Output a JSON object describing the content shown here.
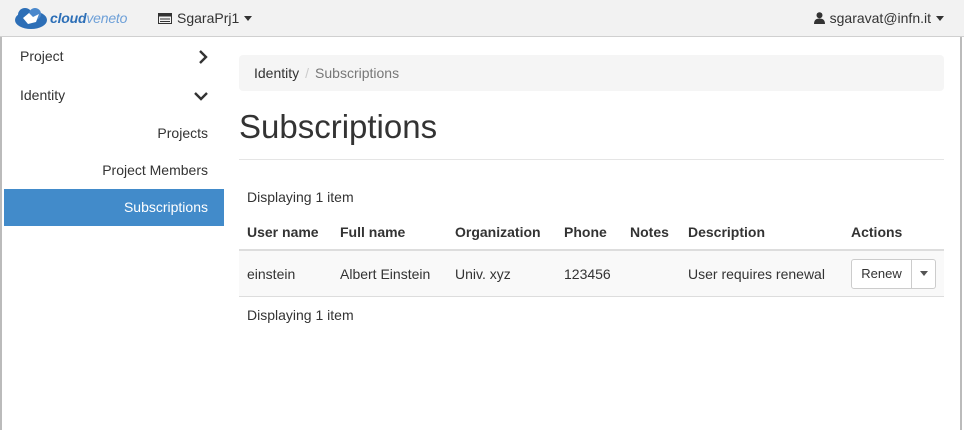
{
  "brand": {
    "name_bold": "cloud",
    "name_light": "veneto"
  },
  "topbar": {
    "project": "SgaraPrj1",
    "user": "sgaravat@infn.it"
  },
  "sidebar": {
    "sections": [
      {
        "label": "Project",
        "expanded": false
      },
      {
        "label": "Identity",
        "expanded": true
      }
    ],
    "identity_items": [
      {
        "label": "Projects",
        "active": false
      },
      {
        "label": "Project Members",
        "active": false
      },
      {
        "label": "Subscriptions",
        "active": true
      }
    ]
  },
  "breadcrumb": {
    "parent": "Identity",
    "separator": "/",
    "current": "Subscriptions"
  },
  "page": {
    "title": "Subscriptions"
  },
  "table": {
    "count_top": "Displaying 1 item",
    "count_bottom": "Displaying 1 item",
    "columns": [
      "User name",
      "Full name",
      "Organization",
      "Phone",
      "Notes",
      "Description",
      "Actions"
    ],
    "rows": [
      {
        "username": "einstein",
        "fullname": "Albert Einstein",
        "organization": "Univ. xyz",
        "phone": "123456",
        "notes": "",
        "description": "User requires renewal",
        "action": "Renew"
      }
    ]
  },
  "colors": {
    "active": "#428bca",
    "topbar": "#f2f2f2",
    "brand": "#2d6fb7"
  }
}
